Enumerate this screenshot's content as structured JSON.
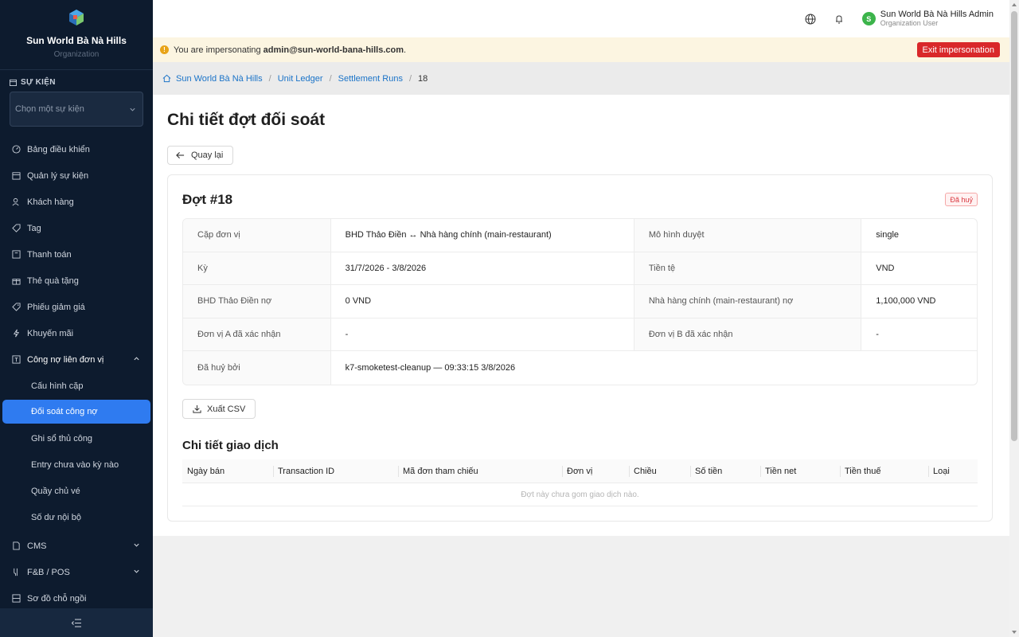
{
  "sidebar": {
    "brand_name": "Sun World Bà Nà Hills",
    "brand_sub": "Organization",
    "section_title": "SỰ KIỆN",
    "event_select_placeholder": "Chọn một sự kiện",
    "items": [
      {
        "label": "Bảng điều khiển",
        "icon": "dashboard-icon"
      },
      {
        "label": "Quản lý sự kiện",
        "icon": "calendar-icon"
      },
      {
        "label": "Khách hàng",
        "icon": "users-icon"
      },
      {
        "label": "Tag",
        "icon": "tag-icon"
      },
      {
        "label": "Thanh toán",
        "icon": "payment-icon"
      },
      {
        "label": "Thẻ quà tặng",
        "icon": "gift-icon"
      },
      {
        "label": "Phiếu giảm giá",
        "icon": "coupon-icon"
      },
      {
        "label": "Khuyến mãi",
        "icon": "promotion-icon"
      },
      {
        "label": "Công nợ liên đơn vị",
        "icon": "ledger-icon"
      }
    ],
    "sub_items": [
      "Cấu hình cặp",
      "Đối soát công nợ",
      "Ghi sổ thủ công",
      "Entry chưa vào kỳ nào",
      "Quầy chủ vé",
      "Số dư nội bộ"
    ],
    "bottom_items": [
      {
        "label": "CMS",
        "icon": "cms-icon"
      },
      {
        "label": "F&B / POS",
        "icon": "fnb-icon"
      },
      {
        "label": "Sơ đồ chỗ ngồi",
        "icon": "seatmap-icon"
      }
    ]
  },
  "topbar": {
    "user_initial": "S",
    "user_name": "Sun World Bà Nà Hills Admin",
    "user_role": "Organization User"
  },
  "banner": {
    "text_prefix": "You are impersonating",
    "email": "admin@sun-world-bana-hills.com",
    "text_suffix": ".",
    "exit_label": "Exit impersonation"
  },
  "breadcrumb": [
    "Sun World Bà Nà Hills",
    "Unit Ledger",
    "Settlement Runs",
    "18"
  ],
  "page": {
    "title": "Chi tiết đợt đối soát",
    "back_label": "Quay lại",
    "card_title": "Đợt #18",
    "status": "Đã huỷ",
    "details": [
      {
        "l1": "Cặp đơn vị",
        "v1": "BHD Thảo Điền ↔ Nhà hàng chính (main-restaurant)",
        "l2": "Mô hình duyệt",
        "v2": "single"
      },
      {
        "l1": "Kỳ",
        "v1": "31/7/2026 - 3/8/2026",
        "l2": "Tiền tệ",
        "v2": "VND"
      },
      {
        "l1": "BHD Thảo Điền nợ",
        "v1": "0 VND",
        "l2": "Nhà hàng chính (main-restaurant) nợ",
        "v2": "1,100,000 VND"
      },
      {
        "l1": "Đơn vị A đã xác nhận",
        "v1": "-",
        "l2": "Đơn vị B đã xác nhận",
        "v2": "-"
      }
    ],
    "cancelled_by_label": "Đã huỷ bởi",
    "cancelled_by_value": "k7-smoketest-cleanup — 09:33:15 3/8/2026",
    "csv_label": "Xuất CSV",
    "tx_title": "Chi tiết giao dịch",
    "tx_columns": [
      "Ngày bán",
      "Transaction ID",
      "Mã đơn tham chiếu",
      "Đơn vị",
      "Chiều",
      "Số tiền",
      "Tiền net",
      "Tiền thuế",
      "Loại"
    ],
    "tx_empty": "Đợt này chưa gom giao dịch nào."
  },
  "colors": {
    "sidebar_bg": "#0d1b2e",
    "active": "#2f7bf0",
    "danger": "#d9282a",
    "link": "#1a73c8"
  }
}
